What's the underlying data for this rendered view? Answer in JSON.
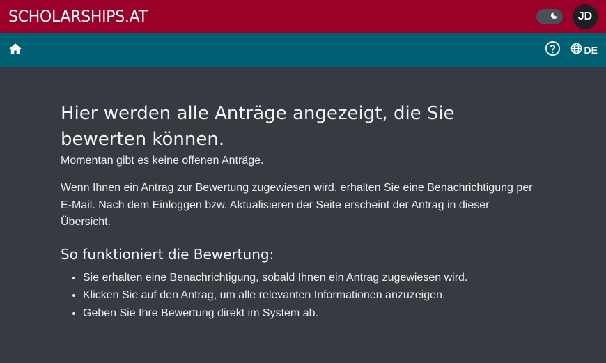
{
  "header": {
    "brand": "SCHOLARSHIPS.AT",
    "avatar_initials": "JD",
    "theme_icon": "moon-icon",
    "colors": {
      "header_bg": "#9b0029",
      "nav_bg": "#006073",
      "page_bg": "#363a41"
    }
  },
  "nav": {
    "home_icon": "home-icon",
    "help_icon": "help-icon",
    "language_icon": "globe-icon",
    "language_label": "DE"
  },
  "main": {
    "title": "Hier werden alle Anträge angezeigt, die Sie bewerten können.",
    "status": "Momentan gibt es keine offenen Anträge.",
    "info": "Wenn Ihnen ein Antrag zur Bewertung zugewiesen wird, erhalten Sie eine Benachrichtigung per E-Mail. Nach dem Einloggen bzw. Aktualisieren der Seite erscheint der Antrag in dieser Übersicht.",
    "section_title": "So funktioniert die Bewertung:",
    "steps": [
      "Sie erhalten eine Benachrichtigung, sobald Ihnen ein Antrag zugewiesen wird.",
      "Klicken Sie auf den Antrag, um alle relevanten Informationen anzuzeigen.",
      "Geben Sie Ihre Bewertung direkt im System ab."
    ]
  }
}
